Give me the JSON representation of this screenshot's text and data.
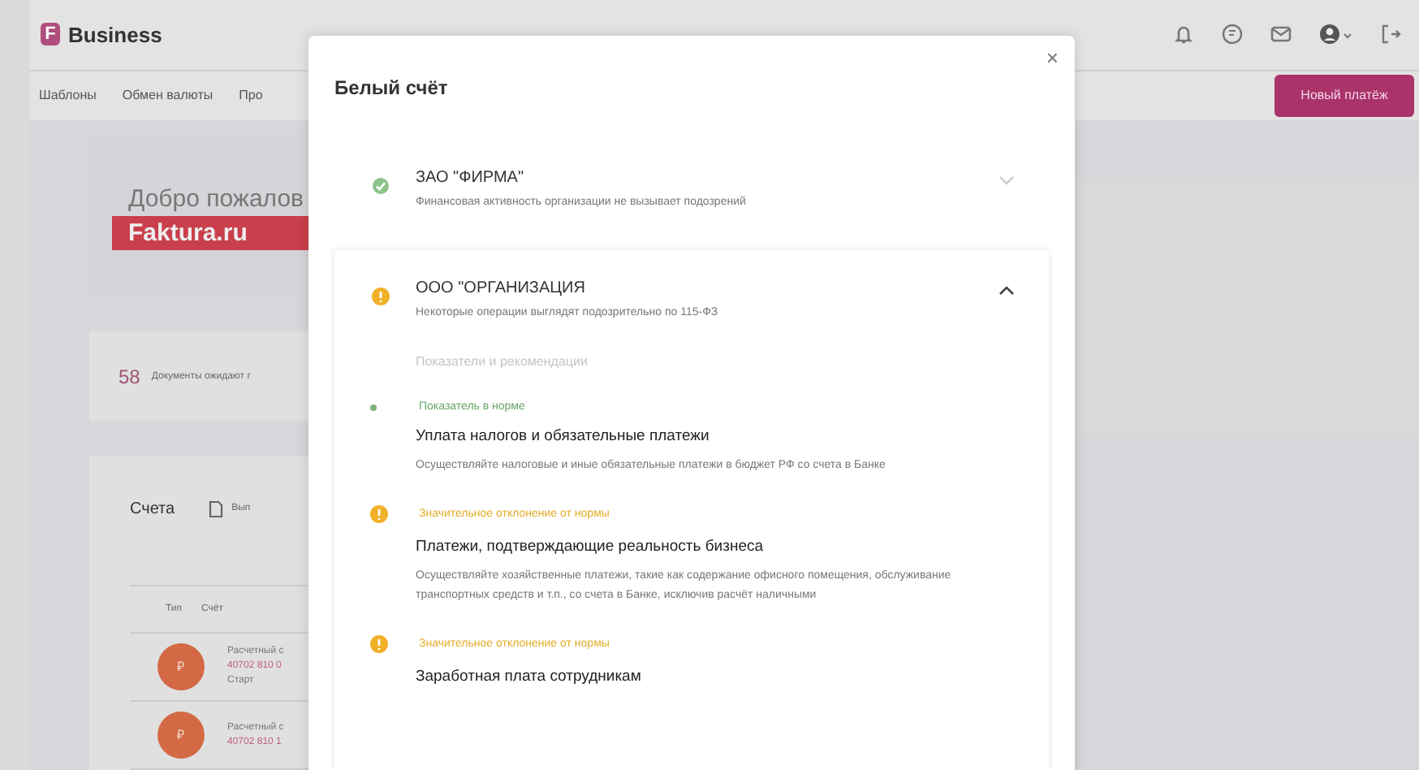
{
  "header": {
    "logo_letter": "F",
    "brand": "Business"
  },
  "nav": {
    "items": [
      "Шаблоны",
      "Обмен валюты",
      "Про"
    ],
    "new_payment": "Новый платёж"
  },
  "banner": {
    "greeting": "Добро пожалов",
    "brand": "Faktura.ru"
  },
  "documents": {
    "count": "58",
    "text": "Документы ожидают г"
  },
  "accounts": {
    "title": "Счета",
    "statement": "Вып",
    "columns": [
      "Тип",
      "Счёт"
    ],
    "rows": [
      {
        "currency": "₽",
        "name": "Расчетный с",
        "number": "40702 810 0",
        "tariff": "Старт"
      },
      {
        "currency": "₽",
        "name": "Расчетный с",
        "number": "40702 810 1"
      }
    ]
  },
  "modal": {
    "title": "Белый счёт",
    "close": "×",
    "companies": [
      {
        "name": "ЗАО \"ФИРМА\"",
        "kind": "ok",
        "summary": "Финансовая активность организации не вызывает подозрений",
        "expanded": false
      },
      {
        "name": "ООО \"ОРГАНИЗАЦИЯ",
        "kind": "warn",
        "summary": "Некоторые операции выглядят подозрительно по 115-ФЗ",
        "expanded": true,
        "section": "Показатели и рекомендации",
        "indicators": [
          {
            "kind": "ok",
            "status": "Показатель в норме",
            "title": "Уплата налогов и обязательные платежи",
            "text": "Осуществляйте налоговые и иные обязательные платежи в бюджет РФ со счета в Банке"
          },
          {
            "kind": "warn",
            "status": "Значительное отклонение от нормы",
            "title": "Платежи, подтверждающие реальность бизнеса",
            "text": "Осуществляйте хозяйственные платежи, такие как содержание офисного помещения, обслуживание транспортных средств и т.п., со счета в Банке, исключив расчёт наличными"
          },
          {
            "kind": "warn",
            "status": "Значительное отклонение от нормы",
            "title": "Заработная плата сотрудникам"
          }
        ]
      }
    ]
  }
}
